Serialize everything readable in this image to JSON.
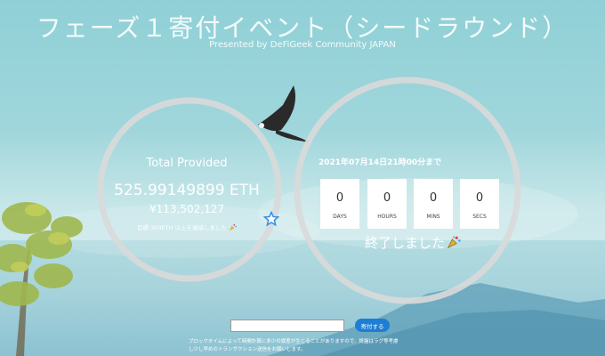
{
  "header": {
    "title": "フェーズ１寄付イベント（シードラウンド）",
    "subtitle": "Presented by DeFiGeek Community JAPAN"
  },
  "total": {
    "label": "Total Provided",
    "eth": "525.99149899 ETH",
    "jpy": "¥113,502,127",
    "goal_text": "目標 300ETH 以上を達成しました",
    "goal_progress": 1.0
  },
  "countdown": {
    "deadline_text": "2021年07月14日21時00分まで",
    "units": [
      {
        "value": "0",
        "label": "DAYS"
      },
      {
        "value": "0",
        "label": "HOURS"
      },
      {
        "value": "0",
        "label": "MINS"
      },
      {
        "value": "0",
        "label": "SECS"
      }
    ],
    "ended_text": "終了しました"
  },
  "donate": {
    "input_value": "",
    "button_label": "寄付する"
  },
  "notice": {
    "line1": "ブロックタイムによって時間計算に多少の誤差が生じることがありますので、終盤はラグ等考慮",
    "line2": "し少し早めのトランザクション送信をお願いします。"
  },
  "colors": {
    "accent": "#1e7ed4",
    "ring": "#d9d9d9",
    "star": "#2f8fe6"
  },
  "icons": [
    "party-popper-icon",
    "star-icon"
  ]
}
